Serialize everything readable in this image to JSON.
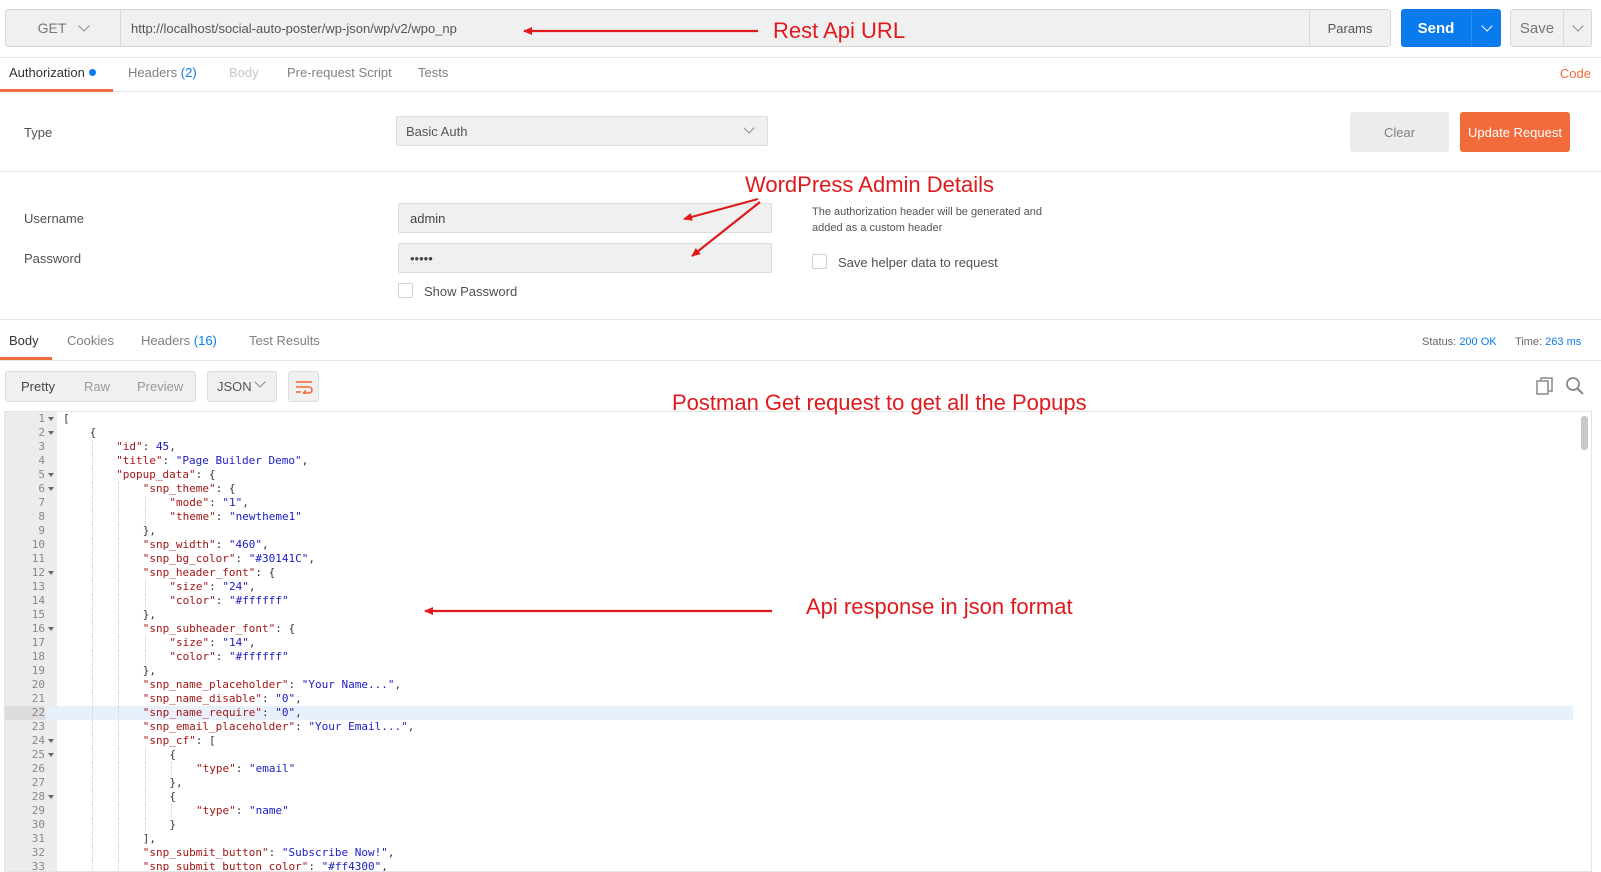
{
  "request": {
    "method": "GET",
    "url": "http://localhost/social-auto-poster/wp-json/wp/v2/wpo_np",
    "params_label": "Params",
    "send_label": "Send",
    "save_label": "Save"
  },
  "request_tabs": {
    "authorization": "Authorization",
    "headers": "Headers",
    "headers_count": "(2)",
    "body": "Body",
    "prerequest": "Pre-request Script",
    "tests": "Tests",
    "code": "Code"
  },
  "auth": {
    "type_label": "Type",
    "type_value": "Basic Auth",
    "clear_label": "Clear",
    "update_label": "Update Request",
    "username_label": "Username",
    "username_value": "admin",
    "password_label": "Password",
    "password_value": "•••••",
    "show_password_label": "Show Password",
    "helper_text": "The authorization header will be generated and added as a custom header",
    "save_helper_label": "Save helper data to request"
  },
  "response_tabs": {
    "body": "Body",
    "cookies": "Cookies",
    "headers": "Headers",
    "headers_count": "(16)",
    "test_results": "Test Results",
    "status_label": "Status:",
    "status_value": "200 OK",
    "time_label": "Time:",
    "time_value": "263 ms"
  },
  "response_toolbar": {
    "pretty": "Pretty",
    "raw": "Raw",
    "preview": "Preview",
    "format": "JSON"
  },
  "code_lines": [
    {
      "n": "1",
      "fold": true,
      "indent": 0,
      "parts": [
        [
          "p",
          "["
        ]
      ]
    },
    {
      "n": "2",
      "fold": true,
      "indent": 1,
      "parts": [
        [
          "p",
          "{"
        ]
      ]
    },
    {
      "n": "3",
      "fold": false,
      "indent": 2,
      "parts": [
        [
          "k",
          "\"id\""
        ],
        [
          "p",
          ": "
        ],
        [
          "n",
          "45"
        ],
        [
          "p",
          ","
        ]
      ]
    },
    {
      "n": "4",
      "fold": false,
      "indent": 2,
      "parts": [
        [
          "k",
          "\"title\""
        ],
        [
          "p",
          ": "
        ],
        [
          "s",
          "\"Page Builder Demo\""
        ],
        [
          "p",
          ","
        ]
      ]
    },
    {
      "n": "5",
      "fold": true,
      "indent": 2,
      "parts": [
        [
          "k",
          "\"popup_data\""
        ],
        [
          "p",
          ": {"
        ]
      ]
    },
    {
      "n": "6",
      "fold": true,
      "indent": 3,
      "parts": [
        [
          "k",
          "\"snp_theme\""
        ],
        [
          "p",
          ": {"
        ]
      ]
    },
    {
      "n": "7",
      "fold": false,
      "indent": 4,
      "parts": [
        [
          "k",
          "\"mode\""
        ],
        [
          "p",
          ": "
        ],
        [
          "s",
          "\"1\""
        ],
        [
          "p",
          ","
        ]
      ]
    },
    {
      "n": "8",
      "fold": false,
      "indent": 4,
      "parts": [
        [
          "k",
          "\"theme\""
        ],
        [
          "p",
          ": "
        ],
        [
          "s",
          "\"newtheme1\""
        ]
      ]
    },
    {
      "n": "9",
      "fold": false,
      "indent": 3,
      "parts": [
        [
          "p",
          "},"
        ]
      ]
    },
    {
      "n": "10",
      "fold": false,
      "indent": 3,
      "parts": [
        [
          "k",
          "\"snp_width\""
        ],
        [
          "p",
          ": "
        ],
        [
          "s",
          "\"460\""
        ],
        [
          "p",
          ","
        ]
      ]
    },
    {
      "n": "11",
      "fold": false,
      "indent": 3,
      "parts": [
        [
          "k",
          "\"snp_bg_color\""
        ],
        [
          "p",
          ": "
        ],
        [
          "s",
          "\"#30141C\""
        ],
        [
          "p",
          ","
        ]
      ]
    },
    {
      "n": "12",
      "fold": true,
      "indent": 3,
      "parts": [
        [
          "k",
          "\"snp_header_font\""
        ],
        [
          "p",
          ": {"
        ]
      ]
    },
    {
      "n": "13",
      "fold": false,
      "indent": 4,
      "parts": [
        [
          "k",
          "\"size\""
        ],
        [
          "p",
          ": "
        ],
        [
          "s",
          "\"24\""
        ],
        [
          "p",
          ","
        ]
      ]
    },
    {
      "n": "14",
      "fold": false,
      "indent": 4,
      "parts": [
        [
          "k",
          "\"color\""
        ],
        [
          "p",
          ": "
        ],
        [
          "s",
          "\"#ffffff\""
        ]
      ]
    },
    {
      "n": "15",
      "fold": false,
      "indent": 3,
      "parts": [
        [
          "p",
          "},"
        ]
      ]
    },
    {
      "n": "16",
      "fold": true,
      "indent": 3,
      "parts": [
        [
          "k",
          "\"snp_subheader_font\""
        ],
        [
          "p",
          ": {"
        ]
      ]
    },
    {
      "n": "17",
      "fold": false,
      "indent": 4,
      "parts": [
        [
          "k",
          "\"size\""
        ],
        [
          "p",
          ": "
        ],
        [
          "s",
          "\"14\""
        ],
        [
          "p",
          ","
        ]
      ]
    },
    {
      "n": "18",
      "fold": false,
      "indent": 4,
      "parts": [
        [
          "k",
          "\"color\""
        ],
        [
          "p",
          ": "
        ],
        [
          "s",
          "\"#ffffff\""
        ]
      ]
    },
    {
      "n": "19",
      "fold": false,
      "indent": 3,
      "parts": [
        [
          "p",
          "},"
        ]
      ]
    },
    {
      "n": "20",
      "fold": false,
      "indent": 3,
      "parts": [
        [
          "k",
          "\"snp_name_placeholder\""
        ],
        [
          "p",
          ": "
        ],
        [
          "s",
          "\"Your Name...\""
        ],
        [
          "p",
          ","
        ]
      ]
    },
    {
      "n": "21",
      "fold": false,
      "indent": 3,
      "parts": [
        [
          "k",
          "\"snp_name_disable\""
        ],
        [
          "p",
          ": "
        ],
        [
          "s",
          "\"0\""
        ],
        [
          "p",
          ","
        ]
      ]
    },
    {
      "n": "22",
      "fold": false,
      "indent": 3,
      "hl": true,
      "parts": [
        [
          "k",
          "\"snp_name_require\""
        ],
        [
          "p",
          ": "
        ],
        [
          "s",
          "\"0\""
        ],
        [
          "p",
          ","
        ]
      ]
    },
    {
      "n": "23",
      "fold": false,
      "indent": 3,
      "parts": [
        [
          "k",
          "\"snp_email_placeholder\""
        ],
        [
          "p",
          ": "
        ],
        [
          "s",
          "\"Your Email...\""
        ],
        [
          "p",
          ","
        ]
      ]
    },
    {
      "n": "24",
      "fold": true,
      "indent": 3,
      "parts": [
        [
          "k",
          "\"snp_cf\""
        ],
        [
          "p",
          ": ["
        ]
      ]
    },
    {
      "n": "25",
      "fold": true,
      "indent": 4,
      "parts": [
        [
          "p",
          "{"
        ]
      ]
    },
    {
      "n": "26",
      "fold": false,
      "indent": 5,
      "parts": [
        [
          "k",
          "\"type\""
        ],
        [
          "p",
          ": "
        ],
        [
          "s",
          "\"email\""
        ]
      ]
    },
    {
      "n": "27",
      "fold": false,
      "indent": 4,
      "parts": [
        [
          "p",
          "},"
        ]
      ]
    },
    {
      "n": "28",
      "fold": true,
      "indent": 4,
      "parts": [
        [
          "p",
          "{"
        ]
      ]
    },
    {
      "n": "29",
      "fold": false,
      "indent": 5,
      "parts": [
        [
          "k",
          "\"type\""
        ],
        [
          "p",
          ": "
        ],
        [
          "s",
          "\"name\""
        ]
      ]
    },
    {
      "n": "30",
      "fold": false,
      "indent": 4,
      "parts": [
        [
          "p",
          "}"
        ]
      ]
    },
    {
      "n": "31",
      "fold": false,
      "indent": 3,
      "parts": [
        [
          "p",
          "],"
        ]
      ]
    },
    {
      "n": "32",
      "fold": false,
      "indent": 3,
      "parts": [
        [
          "k",
          "\"snp_submit_button\""
        ],
        [
          "p",
          ": "
        ],
        [
          "s",
          "\"Subscribe Now!\""
        ],
        [
          "p",
          ","
        ]
      ]
    },
    {
      "n": "33",
      "fold": false,
      "indent": 3,
      "parts": [
        [
          "k",
          "\"snp_submit_button_color\""
        ],
        [
          "p",
          ": "
        ],
        [
          "s",
          "\"#ff4300\""
        ],
        [
          "p",
          ","
        ]
      ]
    }
  ],
  "annotations": {
    "rest_api_url": "Rest Api URL",
    "wp_admin": "WordPress Admin Details",
    "postman_get": "Postman Get request to get all the Popups",
    "api_response": "Api response in json format"
  },
  "colors": {
    "accent_orange": "#f26b3a",
    "send_blue": "#097bed",
    "annotation_red": "#e0191c"
  }
}
